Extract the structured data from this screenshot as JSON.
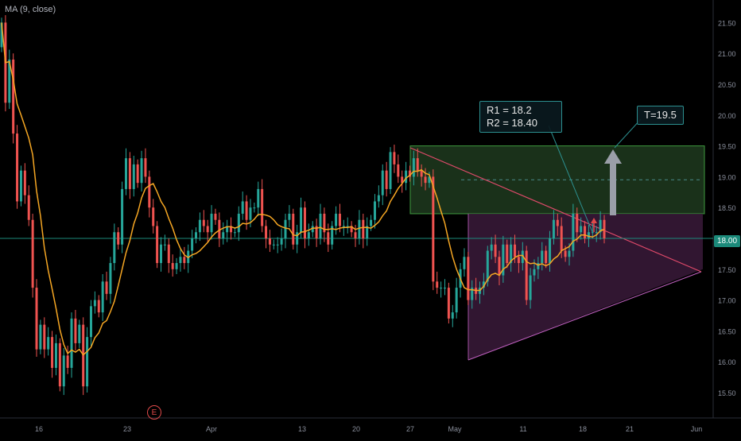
{
  "indicator_label": "MA (9, close)",
  "event_marker": "E",
  "current_price_label": "18.00",
  "annotations": {
    "r1": "R1 = 18.2",
    "r2": "R2 = 18.40",
    "target": "T=19.5"
  },
  "colors": {
    "up": "#26a69a",
    "down": "#ef5350",
    "ma": "#f5a623",
    "resistance_zone": "#1f3a1f",
    "triangle_zone": "#3a1a3a",
    "trendline": "#e04a6a",
    "price_line": "#1b8a7a",
    "grid": "#111318"
  },
  "chart_data": {
    "type": "candlestick",
    "y_axis": {
      "ticks": [
        "21.50",
        "21.00",
        "20.50",
        "20.00",
        "19.50",
        "19.00",
        "18.50",
        "18.00",
        "17.50",
        "17.00",
        "16.50",
        "16.00",
        "15.50"
      ],
      "ylim": [
        15.2,
        21.8
      ]
    },
    "x_axis": {
      "ticks": [
        "16",
        "23",
        "Apr",
        "13",
        "20",
        "27",
        "May",
        "11",
        "18",
        "21",
        "Jun"
      ]
    },
    "close_series": [
      21.5,
      20.2,
      20.9,
      19.7,
      18.6,
      19.1,
      18.7,
      18.3,
      17.2,
      16.2,
      16.6,
      16.2,
      16.4,
      15.9,
      16.3,
      15.6,
      16.1,
      15.9,
      16.7,
      16.3,
      16.6,
      15.6,
      16.4,
      16.9,
      17.0,
      16.8,
      17.3,
      17.1,
      17.6,
      18.1,
      17.9,
      18.8,
      19.3,
      18.8,
      19.2,
      18.9,
      19.3,
      19.0,
      18.5,
      18.2,
      17.6,
      17.9,
      17.9,
      17.6,
      17.5,
      17.6,
      17.7,
      17.6,
      17.8,
      18.0,
      18.1,
      18.3,
      18.2,
      18.1,
      18.4,
      18.3,
      18.0,
      18.1,
      18.2,
      18.1,
      18.1,
      18.4,
      18.6,
      18.3,
      18.5,
      18.5,
      18.8,
      18.2,
      18.0,
      17.9,
      17.9,
      17.9,
      18.0,
      18.3,
      18.4,
      17.9,
      18.1,
      18.5,
      18.0,
      18.1,
      18.2,
      18.0,
      18.4,
      18.1,
      17.9,
      18.2,
      18.4,
      18.2,
      18.2,
      18.2,
      18.1,
      18.0,
      18.3,
      18.0,
      18.2,
      18.3,
      18.6,
      18.7,
      19.1,
      18.8,
      19.4,
      19.2,
      19.0,
      18.9,
      19.1,
      19.0,
      19.3,
      19.1,
      19.0,
      18.9,
      19.0,
      17.3,
      17.2,
      17.2,
      17.2,
      16.7,
      16.8,
      17.2,
      17.5,
      17.7,
      17.0,
      17.2,
      17.1,
      17.2,
      17.3,
      17.8,
      17.9,
      17.7,
      17.4,
      17.9,
      17.6,
      17.9,
      17.7,
      17.6,
      17.8,
      17.0,
      17.4,
      17.5,
      17.6,
      17.8,
      17.6,
      18.0,
      18.3,
      18.2,
      17.8,
      17.7,
      17.8,
      18.4,
      18.1,
      18.2,
      18.0,
      18.1,
      18.1,
      18.1,
      18.3,
      18.0
    ],
    "levels": {
      "resistance_zone": [
        18.4,
        19.5
      ],
      "dashed_mid": 18.95,
      "current_price": 18.0
    }
  }
}
